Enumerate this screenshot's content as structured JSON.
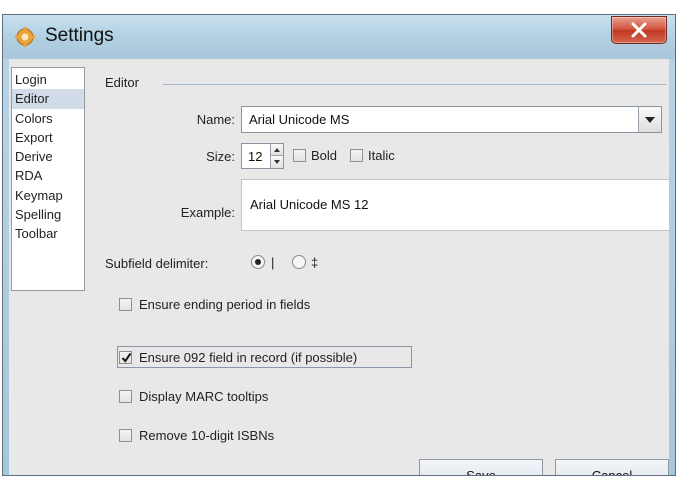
{
  "window": {
    "title": "Settings"
  },
  "nav": {
    "items": [
      "Login",
      "Editor",
      "Colors",
      "Export",
      "Derive",
      "RDA",
      "Keymap",
      "Spelling",
      "Toolbar"
    ],
    "selected": "Editor"
  },
  "editor": {
    "group_label": "Editor",
    "font_name_label": "Name:",
    "font_name_value": "Arial Unicode MS",
    "size_label": "Size:",
    "size_value": "12",
    "bold_label": "Bold",
    "italic_label": "Italic",
    "example_label": "Example:",
    "example_value": "Arial Unicode MS 12",
    "subfield_label": "Subfield delimiter:",
    "subfield_options": [
      "|",
      "‡"
    ],
    "subfield_selected": "|"
  },
  "options": [
    {
      "label": "Ensure ending period in fields",
      "checked": false
    },
    {
      "label": "Ensure 092 field in record (if possible)",
      "checked": true
    },
    {
      "label": "Display MARC tooltips",
      "checked": false
    },
    {
      "label": "Remove 10-digit ISBNs",
      "checked": false
    }
  ],
  "buttons": {
    "save": "Save",
    "cancel": "Cancel"
  },
  "icons": {
    "app": "settings-app-icon",
    "close": "close-icon"
  },
  "colors": {
    "close_button": "#c8412b",
    "title_bar": "#b2d0e2",
    "dialog_bg": "#e8e8e8"
  }
}
